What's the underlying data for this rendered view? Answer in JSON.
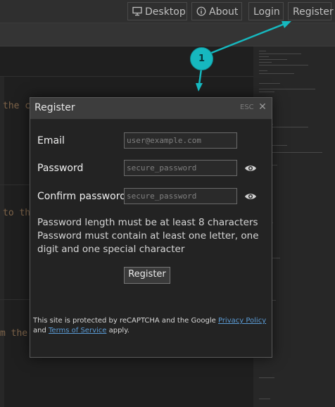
{
  "nav": {
    "desktop_label": "Desktop",
    "about_label": "About",
    "login_label": "Login",
    "register_label": "Register"
  },
  "background": {
    "line1": "the c",
    "line2": "to th",
    "line3": "m the"
  },
  "modal": {
    "title": "Register",
    "esc_label": "ESC",
    "close_glyph": "✕",
    "email_label": "Email",
    "email_placeholder": "user@example.com",
    "password_label": "Password",
    "password_placeholder": "secure_password",
    "confirm_label": "Confirm password",
    "confirm_placeholder": "secure_password",
    "hint_line1": "Password length must be at least 8 characters",
    "hint_line2": "Password must contain at least one letter, one digit and one special character",
    "register_button": "Register",
    "recaptcha_prefix": "This site is protected by reCAPTCHA and the Google",
    "privacy_link": "Privacy Policy",
    "recaptcha_and": "and",
    "terms_link": "Terms of Service",
    "recaptcha_suffix": "apply."
  },
  "callout": {
    "number": "1",
    "color": "#16b8bf"
  },
  "icons": {
    "desktop": "desktop-icon",
    "about": "info-icon",
    "eye": "eye-icon"
  }
}
